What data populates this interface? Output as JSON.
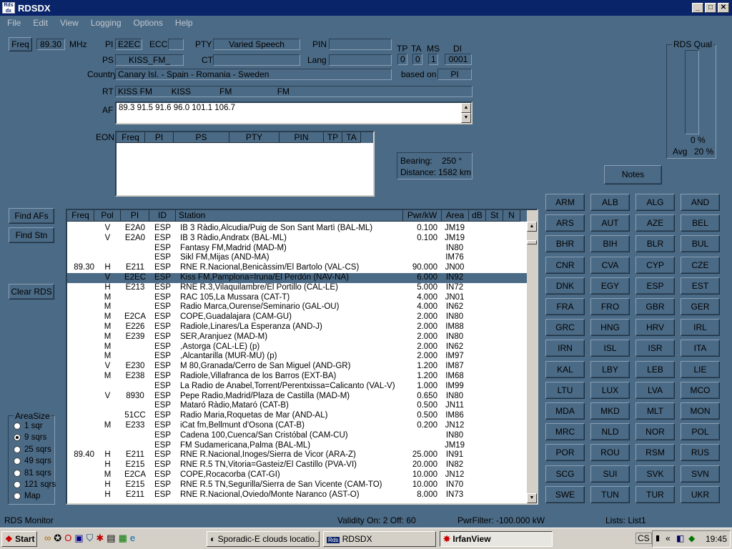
{
  "app": {
    "title": "RDSDX",
    "menu": [
      "File",
      "Edit",
      "View",
      "Logging",
      "Options",
      "Help"
    ]
  },
  "top": {
    "freq_btn": "Freq",
    "freq": "89.30",
    "unit": "MHz",
    "pi_label": "PI",
    "pi": "E2EC",
    "ecc_label": "ECC",
    "ecc": "",
    "pty_label": "PTY",
    "pty": "Varied Speech",
    "pin_label": "PIN",
    "pin": "",
    "ps_label": "PS",
    "ps": "KISS_FM_",
    "ct_label": "CT",
    "ct": "",
    "lang_label": "Lang",
    "lang": "",
    "country_label": "Country",
    "country": "Canary Isl. - Spain - Romania - Sweden",
    "based_on_label": "based on",
    "based_on": "PI",
    "tp_label": "TP",
    "tp": "0",
    "ta_label": "TA",
    "ta": "0",
    "ms_label": "MS",
    "ms": "1",
    "di_label": "DI",
    "di": "0001",
    "rt_label": "RT",
    "rt": "KISS FM        KISS            FM                   FM",
    "af_label": "AF",
    "af": "89.3 91.5 91.6 96.0 101.1 106.7",
    "eon_label": "EON",
    "eon_cols": [
      "Freq",
      "PI",
      "PS",
      "PTY",
      "PIN",
      "TP",
      "TA"
    ],
    "bearing_label": "Bearing:",
    "bearing": "250 °",
    "distance_label": "Distance:",
    "distance": "1582  km",
    "rds_qual_label": "RDS Qual",
    "rds_qual_pct": "0 %",
    "avg_label": "Avg",
    "avg": "20 %",
    "rds_qual_fill": 0,
    "notes_btn": "Notes"
  },
  "side": {
    "find_afs": "Find AFs",
    "find_stn": "Find Stn",
    "clear_rds": "Clear RDS",
    "areasize_label": "AreaSize",
    "areasize_options": [
      "1 sqr",
      "9 sqrs",
      "25 sqrs",
      "49 sqrs",
      "81 sqrs",
      "121 sqrs",
      "Map"
    ],
    "areasize_selected": 1
  },
  "table": {
    "columns": [
      "Freq",
      "Pol",
      "PI",
      "ID",
      "Station",
      "Pwr/kW",
      "Area",
      "dB",
      "St",
      "N"
    ],
    "rows": [
      [
        "",
        "V",
        "E2A0",
        "ESP",
        "IB 3 Ràdio,Alcudia/Puig de Son Sant Martì (BAL-ML)",
        "0.100",
        "JM19"
      ],
      [
        "",
        "V",
        "E2A0",
        "ESP",
        "IB 3 Ràdio,Andratx (BAL-ML)",
        "0.100",
        "JM19"
      ],
      [
        "",
        "",
        "",
        "ESP",
        "Fantasy FM,Madrid (MAD-M)",
        "",
        "IN80"
      ],
      [
        "",
        "",
        "",
        "ESP",
        "Sikl FM,Mijas (AND-MA)",
        "",
        "IM76"
      ],
      [
        "89.30",
        "H",
        "E211",
        "ESP",
        "RNE R.Nacional,Benicàssim/El Bartolo (VAL-CS)",
        "90.000",
        "JN00"
      ],
      [
        "",
        "V",
        "E2EC",
        "ESP",
        "Kiss FM,Pamplona=Iruna/El Perdón (NAV-NA)",
        "6.000",
        "IN92"
      ],
      [
        "",
        "H",
        "E213",
        "ESP",
        "RNE R.3,Vilaquilambre/El Portillo (CAL-LE)",
        "5.000",
        "IN72"
      ],
      [
        "",
        "M",
        "",
        "ESP",
        "RAC 105,La Mussara (CAT-T)",
        "4.000",
        "JN01"
      ],
      [
        "",
        "M",
        "",
        "ESP",
        "Radio Marca,Ourense/Seminario (GAL-OU)",
        "4.000",
        "IN62"
      ],
      [
        "",
        "M",
        "E2CA",
        "ESP",
        "COPE,Guadalajara (CAM-GU)",
        "2.000",
        "IN80"
      ],
      [
        "",
        "M",
        "E226",
        "ESP",
        "Radiole,Linares/La Esperanza (AND-J)",
        "2.000",
        "IM88"
      ],
      [
        "",
        "M",
        "E239",
        "ESP",
        "SER,Aranjuez (MAD-M)",
        "2.000",
        "IN80"
      ],
      [
        "",
        "M",
        "",
        "ESP",
        ",Astorga (CAL-LE) (p)",
        "2.000",
        "IN62"
      ],
      [
        "",
        "M",
        "",
        "ESP",
        ",Alcantarilla (MUR-MU) (p)",
        "2.000",
        "IM97"
      ],
      [
        "",
        "V",
        "E230",
        "ESP",
        "M 80,Granada/Cerro de San Miguel (AND-GR)",
        "1.200",
        "IM87"
      ],
      [
        "",
        "M",
        "E238",
        "ESP",
        "Radiole,Villafranca de los Barros (EXT-BA)",
        "1.200",
        "IM68"
      ],
      [
        "",
        "",
        "",
        "ESP",
        "La Radio de Anabel,Torrent/Perentxissa=Calicanto (VAL-V)",
        "1.000",
        "IM99"
      ],
      [
        "",
        "V",
        "8930",
        "ESP",
        "Pepe Radio,Madrid/Plaza de Castilla (MAD-M)",
        "0.650",
        "IN80"
      ],
      [
        "",
        "",
        "",
        "ESP",
        "Mataró Ràdio,Mataró (CAT-B)",
        "0.500",
        "JN11"
      ],
      [
        "",
        "",
        "51CC",
        "ESP",
        "Radio Maria,Roquetas de Mar (AND-AL)",
        "0.500",
        "IM86"
      ],
      [
        "",
        "M",
        "E233",
        "ESP",
        "iCat fm,Bellmunt d'Osona (CAT-B)",
        "0.200",
        "JN12"
      ],
      [
        "",
        "",
        "",
        "ESP",
        "Cadena 100,Cuenca/San Cristóbal (CAM-CU)",
        "",
        "IN80"
      ],
      [
        "",
        "",
        "",
        "ESP",
        "FM Sudamericana,Palma (BAL-ML)",
        "",
        "JM19"
      ],
      [
        "89.40",
        "H",
        "E211",
        "ESP",
        "RNE R.Nacional,Inoges/Sierra de Vicor (ARA-Z)",
        "25.000",
        "IN91"
      ],
      [
        "",
        "H",
        "E215",
        "ESP",
        "RNE R.5 TN,Vitoria=Gasteiz/El Castillo (PVA-VI)",
        "20.000",
        "IN82"
      ],
      [
        "",
        "M",
        "E2CA",
        "ESP",
        "COPE,Rocacorba (CAT-GI)",
        "10.000",
        "JN12"
      ],
      [
        "",
        "H",
        "E215",
        "ESP",
        "RNE R.5 TN,Segurilla/Sierra de San Vicente (CAM-TO)",
        "10.000",
        "IN70"
      ],
      [
        "",
        "H",
        "E211",
        "ESP",
        "RNE R.Nacional,Oviedo/Monte Naranco (AST-O)",
        "8.000",
        "IN73"
      ]
    ],
    "selected": 5
  },
  "countries": [
    "ARM",
    "ALB",
    "ALG",
    "AND",
    "ARS",
    "AUT",
    "AZE",
    "BEL",
    "BHR",
    "BIH",
    "BLR",
    "BUL",
    "CNR",
    "CVA",
    "CYP",
    "CZE",
    "DNK",
    "EGY",
    "ESP",
    "EST",
    "FRA",
    "FRO",
    "GBR",
    "GER",
    "GRC",
    "HNG",
    "HRV",
    "IRL",
    "IRN",
    "ISL",
    "ISR",
    "ITA",
    "KAL",
    "LBY",
    "LEB",
    "LIE",
    "LTU",
    "LUX",
    "LVA",
    "MCO",
    "MDA",
    "MKD",
    "MLT",
    "MON",
    "MRC",
    "NLD",
    "NOR",
    "POL",
    "POR",
    "ROU",
    "RSM",
    "RUS",
    "SCG",
    "SUI",
    "SVK",
    "SVN",
    "SWE",
    "TUN",
    "TUR",
    "UKR"
  ],
  "status": {
    "left": "RDS Monitor",
    "validity": "Validity On: 2  Off: 60",
    "pwrfilter": "PwrFilter: -100.000 kW",
    "lists": "Lists: List1"
  },
  "taskbar": {
    "start": "Start",
    "tasks": [
      "Sporadic-E clouds locatio...",
      "RDSDX",
      "IrfanView"
    ],
    "tray_cs": "CS",
    "clock": "19:45"
  }
}
